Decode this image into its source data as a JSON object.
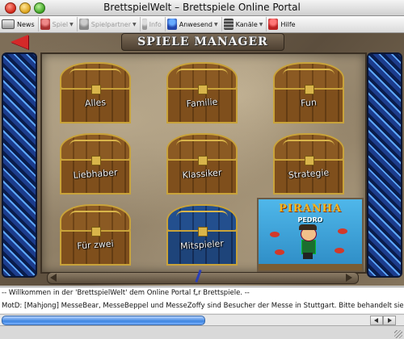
{
  "window": {
    "title": "BrettspielWelt – Brettspiele Online Portal"
  },
  "toolbar": {
    "items": [
      {
        "label": "News",
        "icon": "news-icon",
        "enabled": true,
        "dropdown": false
      },
      {
        "label": "Spiel",
        "icon": "game-icon",
        "enabled": false,
        "dropdown": true
      },
      {
        "label": "Spielpartner",
        "icon": "partner-icon",
        "enabled": false,
        "dropdown": true
      },
      {
        "label": "Info",
        "icon": "info-icon",
        "enabled": false,
        "dropdown": false
      },
      {
        "label": "Anwesend",
        "icon": "present-icon",
        "enabled": true,
        "dropdown": true
      },
      {
        "label": "Kanäle",
        "icon": "channels-icon",
        "enabled": true,
        "dropdown": true
      },
      {
        "label": "Hilfe",
        "icon": "help-icon",
        "enabled": true,
        "dropdown": false
      }
    ]
  },
  "header": {
    "banner": "SPIELE MANAGER"
  },
  "chests": [
    {
      "label": "Alles",
      "color": "brown"
    },
    {
      "label": "Familie",
      "color": "brown"
    },
    {
      "label": "Fun",
      "color": "brown"
    },
    {
      "label": "Liebhaber",
      "color": "brown"
    },
    {
      "label": "Klassiker",
      "color": "brown"
    },
    {
      "label": "Strategie",
      "color": "brown"
    },
    {
      "label": "Für zwei",
      "color": "brown"
    },
    {
      "label": "Mitspieler",
      "color": "blue"
    }
  ],
  "ad": {
    "title": "PIRANHA",
    "subtitle": "PEDRO"
  },
  "chat": {
    "lines": [
      "-- Willkommen in der 'BrettspielWelt' dem Online Portal f„r Brettspiele. --",
      "MotD: [Mahjong] MesseBear, MesseBeppel und MesseZoffy sind Besucher der Messe in Stuttgart. Bitte behandelt sie entsprechend"
    ]
  },
  "colors": {
    "accent_arrow": "#d42929",
    "scroll_thumb": "#3d84e0",
    "chest_gold": "#c9a33a"
  }
}
